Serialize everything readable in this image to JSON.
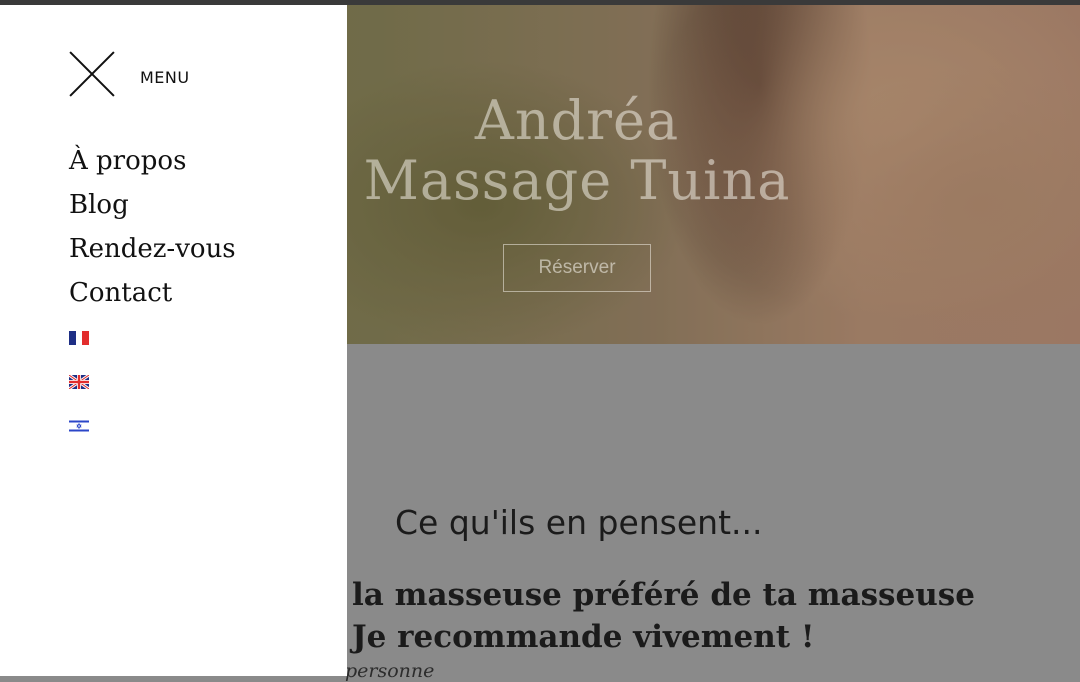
{
  "hero": {
    "title_line1": "Andréa",
    "title_line2": "Massage Tuina",
    "reserve_button": "Réserver"
  },
  "testimonials": {
    "title": "Ce qu'ils en pensent...",
    "quote_line1": "la masseuse préféré de ta masseuse",
    "quote_line2": "Je recommande vivement !",
    "author_partial": "personne"
  },
  "menu": {
    "label": "MENU",
    "items": [
      "À propos",
      "Blog",
      "Rendez-vous",
      "Contact"
    ],
    "languages": [
      {
        "icon": "flag-fr-icon",
        "name": "Français"
      },
      {
        "icon": "flag-gb-icon",
        "name": "English"
      },
      {
        "icon": "flag-il-icon",
        "name": "Hebrew"
      }
    ]
  },
  "colors": {
    "menu_background": "#ffffff",
    "text": "#111111",
    "overlay_gray": "#8a8a8a",
    "flag_blue": "#1e2f85",
    "flag_red": "#e22d2d"
  }
}
